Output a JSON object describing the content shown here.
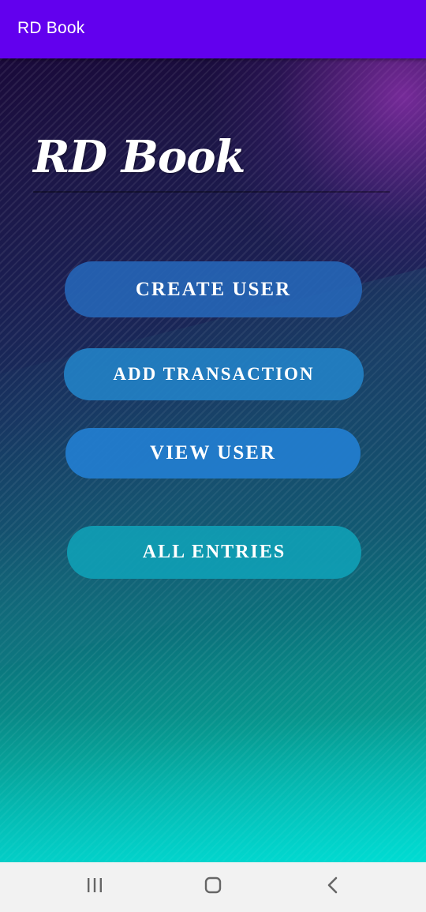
{
  "appbar": {
    "title": "RD Book"
  },
  "main": {
    "logo_text": "RD Book",
    "buttons": {
      "create_user": "CREATE USER",
      "add_transaction": "ADD TRANSACTION",
      "view_user": "VIEW USER",
      "all_entries": "ALL ENTRIES"
    }
  },
  "navbar": {
    "icons": [
      "recent-apps-icon",
      "home-icon",
      "back-icon"
    ]
  },
  "colors": {
    "appbar": "#6200ee",
    "button_text": "#ffffff",
    "navbar": "#f2f2f2"
  }
}
